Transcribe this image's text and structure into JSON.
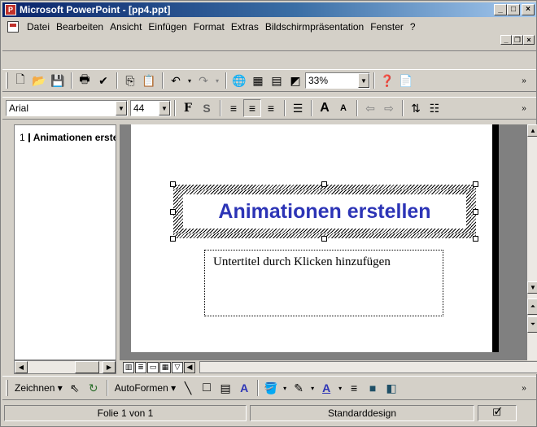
{
  "window": {
    "title": "Microsoft PowerPoint - [pp4.ppt]",
    "app_icon_glyph": "P",
    "controls": {
      "minimize": "_",
      "maximize": "□",
      "close": "×"
    }
  },
  "menubar": {
    "items": [
      "Datei",
      "Bearbeiten",
      "Ansicht",
      "Einfügen",
      "Format",
      "Extras",
      "Bildschirmpräsentation",
      "Fenster",
      "?"
    ],
    "doc_controls": {
      "minimize": "_",
      "restore": "❐",
      "close": "×"
    }
  },
  "toolbar_standard": {
    "zoom": "33%"
  },
  "toolbar_format": {
    "font_name": "Arial",
    "font_size": "44",
    "bold_label": "F",
    "shadow_label": "S"
  },
  "outline": {
    "slide_number": "1",
    "slide_title": "Animationen erstellen"
  },
  "slide": {
    "title": "Animationen erstellen",
    "subtitle_placeholder": "Untertitel durch Klicken hinzufügen",
    "title_color": "#2c34b6"
  },
  "drawbar": {
    "draw_label": "Zeichnen",
    "autoshapes_label": "AutoFormen"
  },
  "statusbar": {
    "slide_info": "Folie 1 von 1",
    "design": "Standarddesign"
  }
}
